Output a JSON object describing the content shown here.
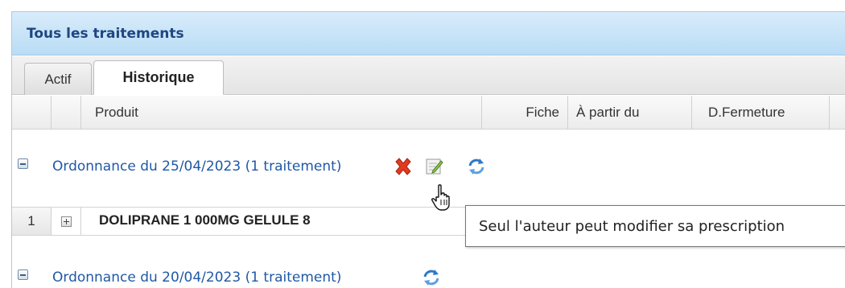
{
  "panel": {
    "title": "Tous les traitements"
  },
  "tabs": [
    {
      "label": "Actif",
      "selected": false
    },
    {
      "label": "Historique",
      "selected": true
    }
  ],
  "columns": [
    "",
    "",
    "Produit",
    "Fiche",
    "À partir du",
    "D.Fermeture"
  ],
  "groups": [
    {
      "label": "Ordonnance du 25/04/2023 (1 traitement)",
      "icons": [
        "delete-icon",
        "edit-icon",
        "refresh-icon"
      ],
      "rows": [
        {
          "index": "1",
          "product": "DOLIPRANE 1 000MG GELULE 8"
        }
      ]
    },
    {
      "label": "Ordonnance du 20/04/2023 (1 traitement)",
      "icons": [
        "refresh-icon"
      ],
      "rows": []
    }
  ],
  "tooltip": {
    "text": "Seul l'auteur peut modifier sa prescription"
  },
  "colors": {
    "header_bg": "#c6e3f8",
    "title": "#1f4680",
    "link": "#1f58a6",
    "delete": "#e03b1f",
    "refresh": "#2f78c8"
  }
}
